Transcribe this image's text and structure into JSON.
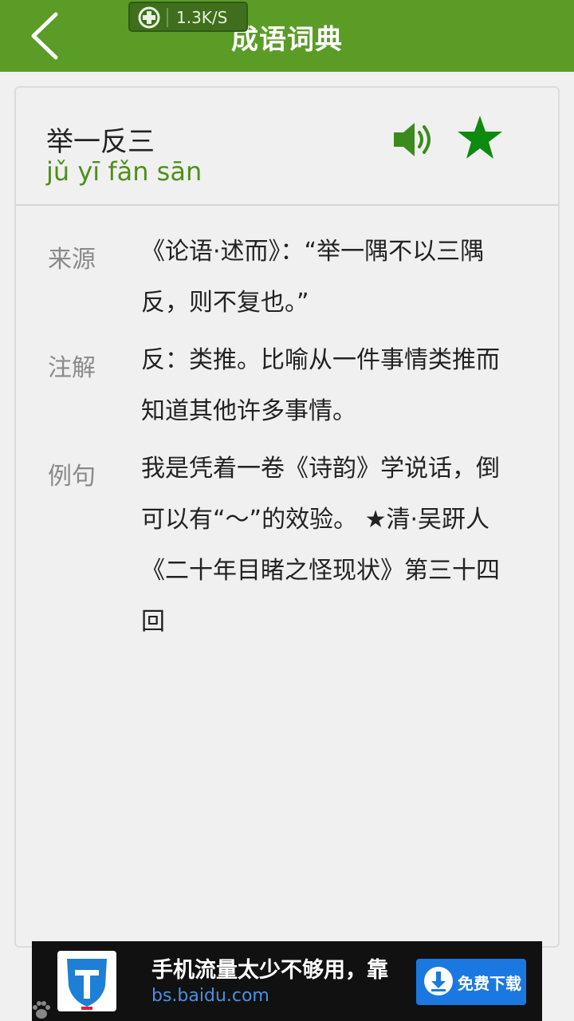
{
  "header": {
    "title": "成语词典",
    "accent": "#5a9c25"
  },
  "status_overlay": {
    "rate": "1.3K/S"
  },
  "entry": {
    "idiom": "举一反三",
    "pinyin": "jǔ yī fǎn sān",
    "sections": [
      {
        "label": "来源",
        "text": "《论语·述而》：“举一隅不以三隅反，则不复也。”"
      },
      {
        "label": "注解",
        "text": "反：类推。比喻从一件事情类推而知道其他许多事情。"
      },
      {
        "label": "例句",
        "text": "我是凭着一卷《诗韵》学说话，倒可以有“～”的效验。 ★清·吴趼人《二十年目睹之怪现状》第三十四回"
      }
    ]
  },
  "ad": {
    "text": "手机流量太少不够用，靠",
    "url": "bs.baidu.com",
    "button": "免费下载"
  }
}
